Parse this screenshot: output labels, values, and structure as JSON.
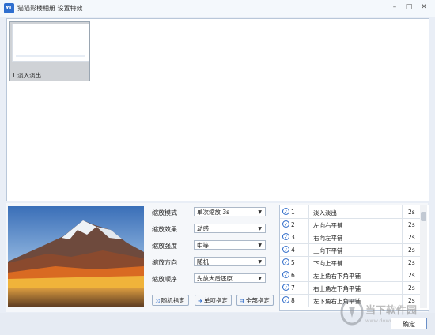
{
  "window": {
    "icon_text": "YL",
    "title": "猫猫影楼相册  设置特效",
    "minimize": "–",
    "maximize": "□",
    "close": "✕"
  },
  "gallery": {
    "items": [
      {
        "label": "1.淡入淡出"
      }
    ]
  },
  "settings": {
    "rows": [
      {
        "label": "缩放模式",
        "value": "单次缩放 3s"
      },
      {
        "label": "缩放效果",
        "value": "动感"
      },
      {
        "label": "缩放强度",
        "value": "中等"
      },
      {
        "label": "缩放方向",
        "value": "随机"
      },
      {
        "label": "缩放顺序",
        "value": "先放大后还原"
      }
    ]
  },
  "buttons": {
    "random_label": "随机指定",
    "single_label": "单项指定",
    "all_label": "全部指定"
  },
  "effects_list": {
    "rows": [
      {
        "num": "1",
        "name": "淡入淡出",
        "duration": "2s"
      },
      {
        "num": "2",
        "name": "左向右平铺",
        "duration": "2s"
      },
      {
        "num": "3",
        "name": "右向左平铺",
        "duration": "2s"
      },
      {
        "num": "4",
        "name": "上向下平铺",
        "duration": "2s"
      },
      {
        "num": "5",
        "name": "下向上平铺",
        "duration": "2s"
      },
      {
        "num": "6",
        "name": "左上角右下角平铺",
        "duration": "2s"
      },
      {
        "num": "7",
        "name": "右上角左下角平铺",
        "duration": "2s"
      },
      {
        "num": "8",
        "name": "左下角右上角平铺",
        "duration": "2s"
      }
    ]
  },
  "footer": {
    "ok_label": "确定"
  },
  "watermark": {
    "name": "当下软件园",
    "url": "www.downxia.com"
  }
}
